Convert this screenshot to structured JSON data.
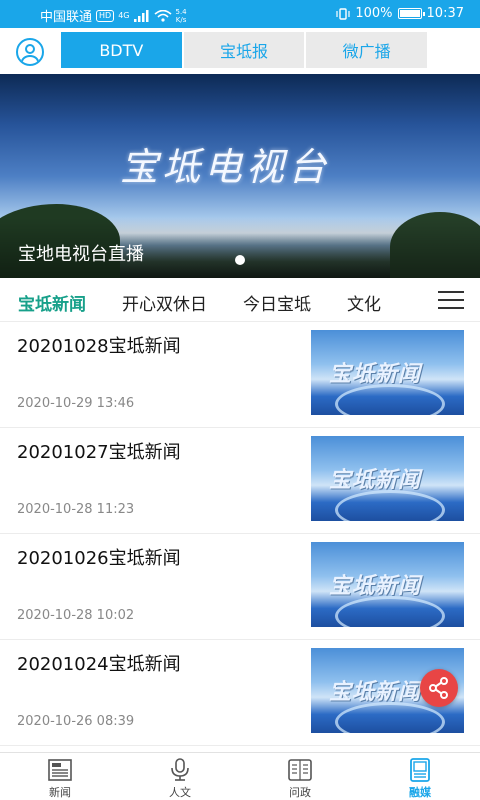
{
  "status_bar": {
    "carrier": "中国联通",
    "hd": "HD",
    "network": "4G",
    "speed_value": "5.4",
    "speed_unit": "K/s",
    "battery": "100%",
    "time": "10:37"
  },
  "header": {
    "tabs": [
      {
        "label": "BDTV",
        "active": true
      },
      {
        "label": "宝坻报",
        "active": false
      },
      {
        "label": "微广播",
        "active": false
      }
    ]
  },
  "banner": {
    "logo_text": "宝坻电视台",
    "caption": "宝地电视台直播"
  },
  "categories": {
    "items": [
      {
        "label": "宝坻新闻",
        "active": true
      },
      {
        "label": "开心双休日",
        "active": false
      },
      {
        "label": "今日宝坻",
        "active": false
      },
      {
        "label": "文化",
        "active": false
      }
    ]
  },
  "news": [
    {
      "title": "20201028宝坻新闻",
      "date": "2020-10-29 13:46",
      "thumb_text": "宝坻新闻"
    },
    {
      "title": "20201027宝坻新闻",
      "date": "2020-10-28 11:23",
      "thumb_text": "宝坻新闻"
    },
    {
      "title": "20201026宝坻新闻",
      "date": "2020-10-28 10:02",
      "thumb_text": "宝坻新闻"
    },
    {
      "title": "20201024宝坻新闻",
      "date": "2020-10-26 08:39",
      "thumb_text": "宝坻新闻"
    }
  ],
  "bottom_nav": {
    "items": [
      {
        "label": "新闻",
        "icon": "newspaper-icon",
        "active": false
      },
      {
        "label": "人文",
        "icon": "microphone-icon",
        "active": false
      },
      {
        "label": "问政",
        "icon": "document-icon",
        "active": false
      },
      {
        "label": "融媒",
        "icon": "media-icon",
        "active": true
      }
    ]
  },
  "colors": {
    "accent": "#1aa6e9",
    "category_active": "#17a08a",
    "share": "#e84545"
  }
}
